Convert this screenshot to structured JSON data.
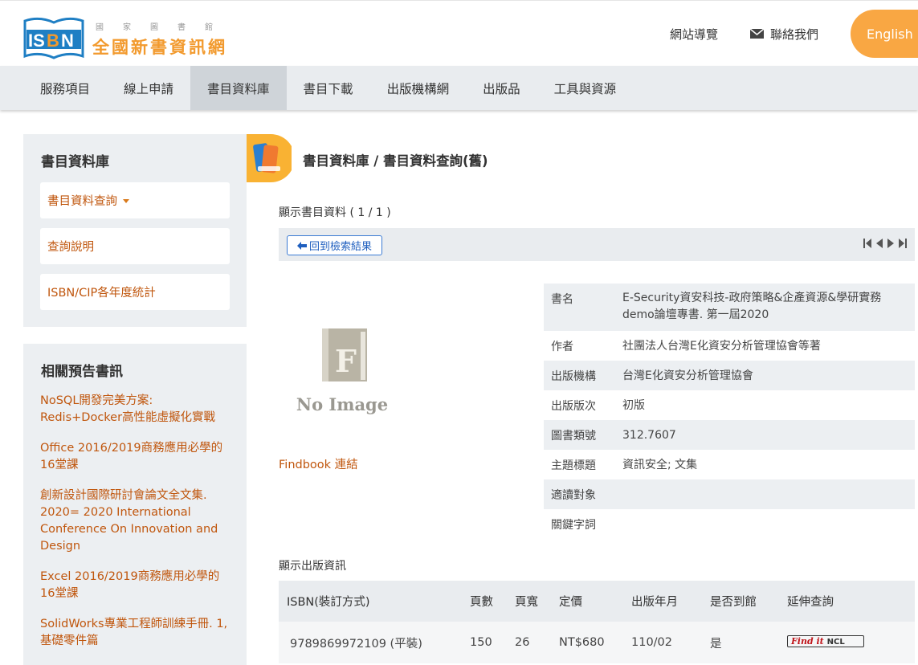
{
  "header": {
    "logo_mark": "ISBN",
    "logo_sub": [
      "國",
      "家",
      "圖",
      "書",
      "館"
    ],
    "logo_title": "全國新書資訊網",
    "links": {
      "sitemap": "網站導覽",
      "contact": "聯絡我們",
      "language": "English"
    },
    "accent_color": "#f9a743"
  },
  "nav": {
    "items": [
      "服務項目",
      "線上申請",
      "書目資料庫",
      "書目下載",
      "出版機構網",
      "出版品",
      "工具與資源"
    ],
    "active": "書目資料庫"
  },
  "sidebar": {
    "title": "書目資料庫",
    "menu": [
      "書目資料查詢",
      "查詢說明",
      "ISBN/CIP各年度統計"
    ],
    "related_title": "相關預告書訊",
    "related": [
      "NoSQL開發完美方案: Redis+Docker高性能虛擬化實戰",
      "Office 2016/2019商務應用必學的16堂課",
      "創新設計國際研討會論文全文集. 2020= 2020 International Conference On Innovation and Design",
      "Excel 2016/2019商務應用必學的16堂課",
      "SolidWorks專業工程師訓練手冊. 1, 基礎零件篇"
    ]
  },
  "main": {
    "breadcrumb": "書目資料庫 / 書目資料查詢(舊)",
    "record_title": "顯示書目資料 ( 1 / 1 )",
    "back_button": "回到檢索結果",
    "no_image_text": "No Image",
    "findbook_link": "Findbook 連結",
    "info": [
      {
        "label": "書名",
        "value": "E-Security資安科技-政府策略&企產資源&學研實務demo論壇專書. 第一屆2020"
      },
      {
        "label": "作者",
        "value": "社團法人台灣E化資安分析管理協會等著"
      },
      {
        "label": "出版機構",
        "value": "台灣E化資安分析管理協會"
      },
      {
        "label": "出版版次",
        "value": "初版"
      },
      {
        "label": "圖書類號",
        "value": "312.7607"
      },
      {
        "label": "主題標題",
        "value": "資訊安全; 文集"
      },
      {
        "label": "適讀對象",
        "value": ""
      },
      {
        "label": "關鍵字詞",
        "value": ""
      }
    ],
    "pub_title": "顯示出版資訊",
    "pub_headers": [
      "ISBN(裝訂方式)",
      "頁數",
      "頁寬",
      "定價",
      "出版年月",
      "是否到館",
      "延伸查詢"
    ],
    "pub_row": {
      "isbn": "9789869972109 (平裝)",
      "pages": "150",
      "width": "26",
      "price": "NT$680",
      "date": "110/02",
      "arrived": "是",
      "findit_label": "Find it",
      "findit_org": "NCL"
    }
  }
}
